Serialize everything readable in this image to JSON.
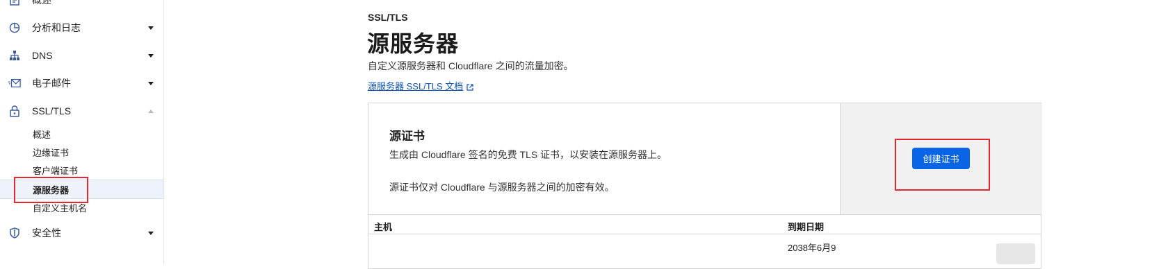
{
  "sidebar": {
    "items": [
      {
        "label": "概述",
        "icon": "document-icon"
      },
      {
        "label": "分析和日志",
        "icon": "pie-chart-icon"
      },
      {
        "label": "DNS",
        "icon": "network-icon"
      },
      {
        "label": "电子邮件",
        "icon": "email-icon"
      },
      {
        "label": "SSL/TLS",
        "icon": "lock-icon"
      },
      {
        "label": "安全性",
        "icon": "shield-icon"
      }
    ],
    "ssl_subitems": [
      {
        "label": "概述"
      },
      {
        "label": "边缘证书"
      },
      {
        "label": "客户端证书"
      },
      {
        "label": "源服务器"
      },
      {
        "label": "自定义主机名"
      }
    ]
  },
  "header": {
    "eyebrow": "SSL/TLS",
    "title": "源服务器",
    "description": "自定义源服务器和 Cloudflare 之间的流量加密。",
    "doc_link": "源服务器 SSL/TLS 文档"
  },
  "card": {
    "title": "源证书",
    "description": "生成由 Cloudflare 签名的免费 TLS 证书，以安装在源服务器上。",
    "note": "源证书仅对 Cloudflare 与源服务器之间的加密有效。",
    "create_button": "创建证书",
    "table": {
      "headers": {
        "host": "主机",
        "expiry": "到期日期"
      },
      "rows": [
        {
          "host": "",
          "expiry": "2038年6月9",
          "action_link": "",
          "action_button": ""
        }
      ]
    }
  },
  "colors": {
    "accent": "#0a64e6",
    "highlight": "#e0282e",
    "link": "#0a52b8"
  }
}
